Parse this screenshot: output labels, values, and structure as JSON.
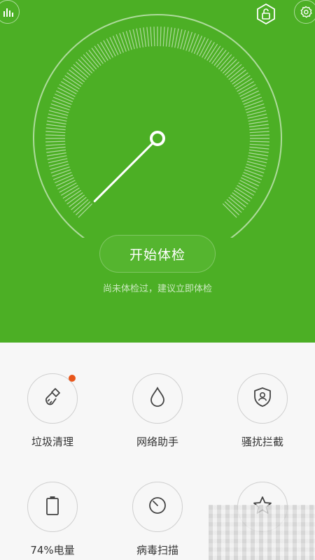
{
  "header": {
    "stats_icon": "bar-chart-icon",
    "shield_icon": "lock-shield-icon",
    "settings_icon": "gear-icon"
  },
  "gauge": {
    "needle_level": 0
  },
  "start_button": {
    "label": "开始体检"
  },
  "hint_text": "尚未体检过，建议立即体检",
  "tools": [
    {
      "label": "垃圾清理",
      "icon": "broom-icon",
      "has_badge": true
    },
    {
      "label": "网络助手",
      "icon": "drop-icon",
      "has_badge": false
    },
    {
      "label": "骚扰拦截",
      "icon": "shield-user-icon",
      "has_badge": false
    },
    {
      "label": "74%电量",
      "icon": "battery-icon",
      "has_badge": false
    },
    {
      "label": "病毒扫描",
      "icon": "scan-dial-icon",
      "has_badge": false
    },
    {
      "label": "",
      "icon": "star-icon",
      "has_badge": false
    }
  ],
  "colors": {
    "brand_green": "#4caf25",
    "badge_orange": "#e8561b"
  }
}
